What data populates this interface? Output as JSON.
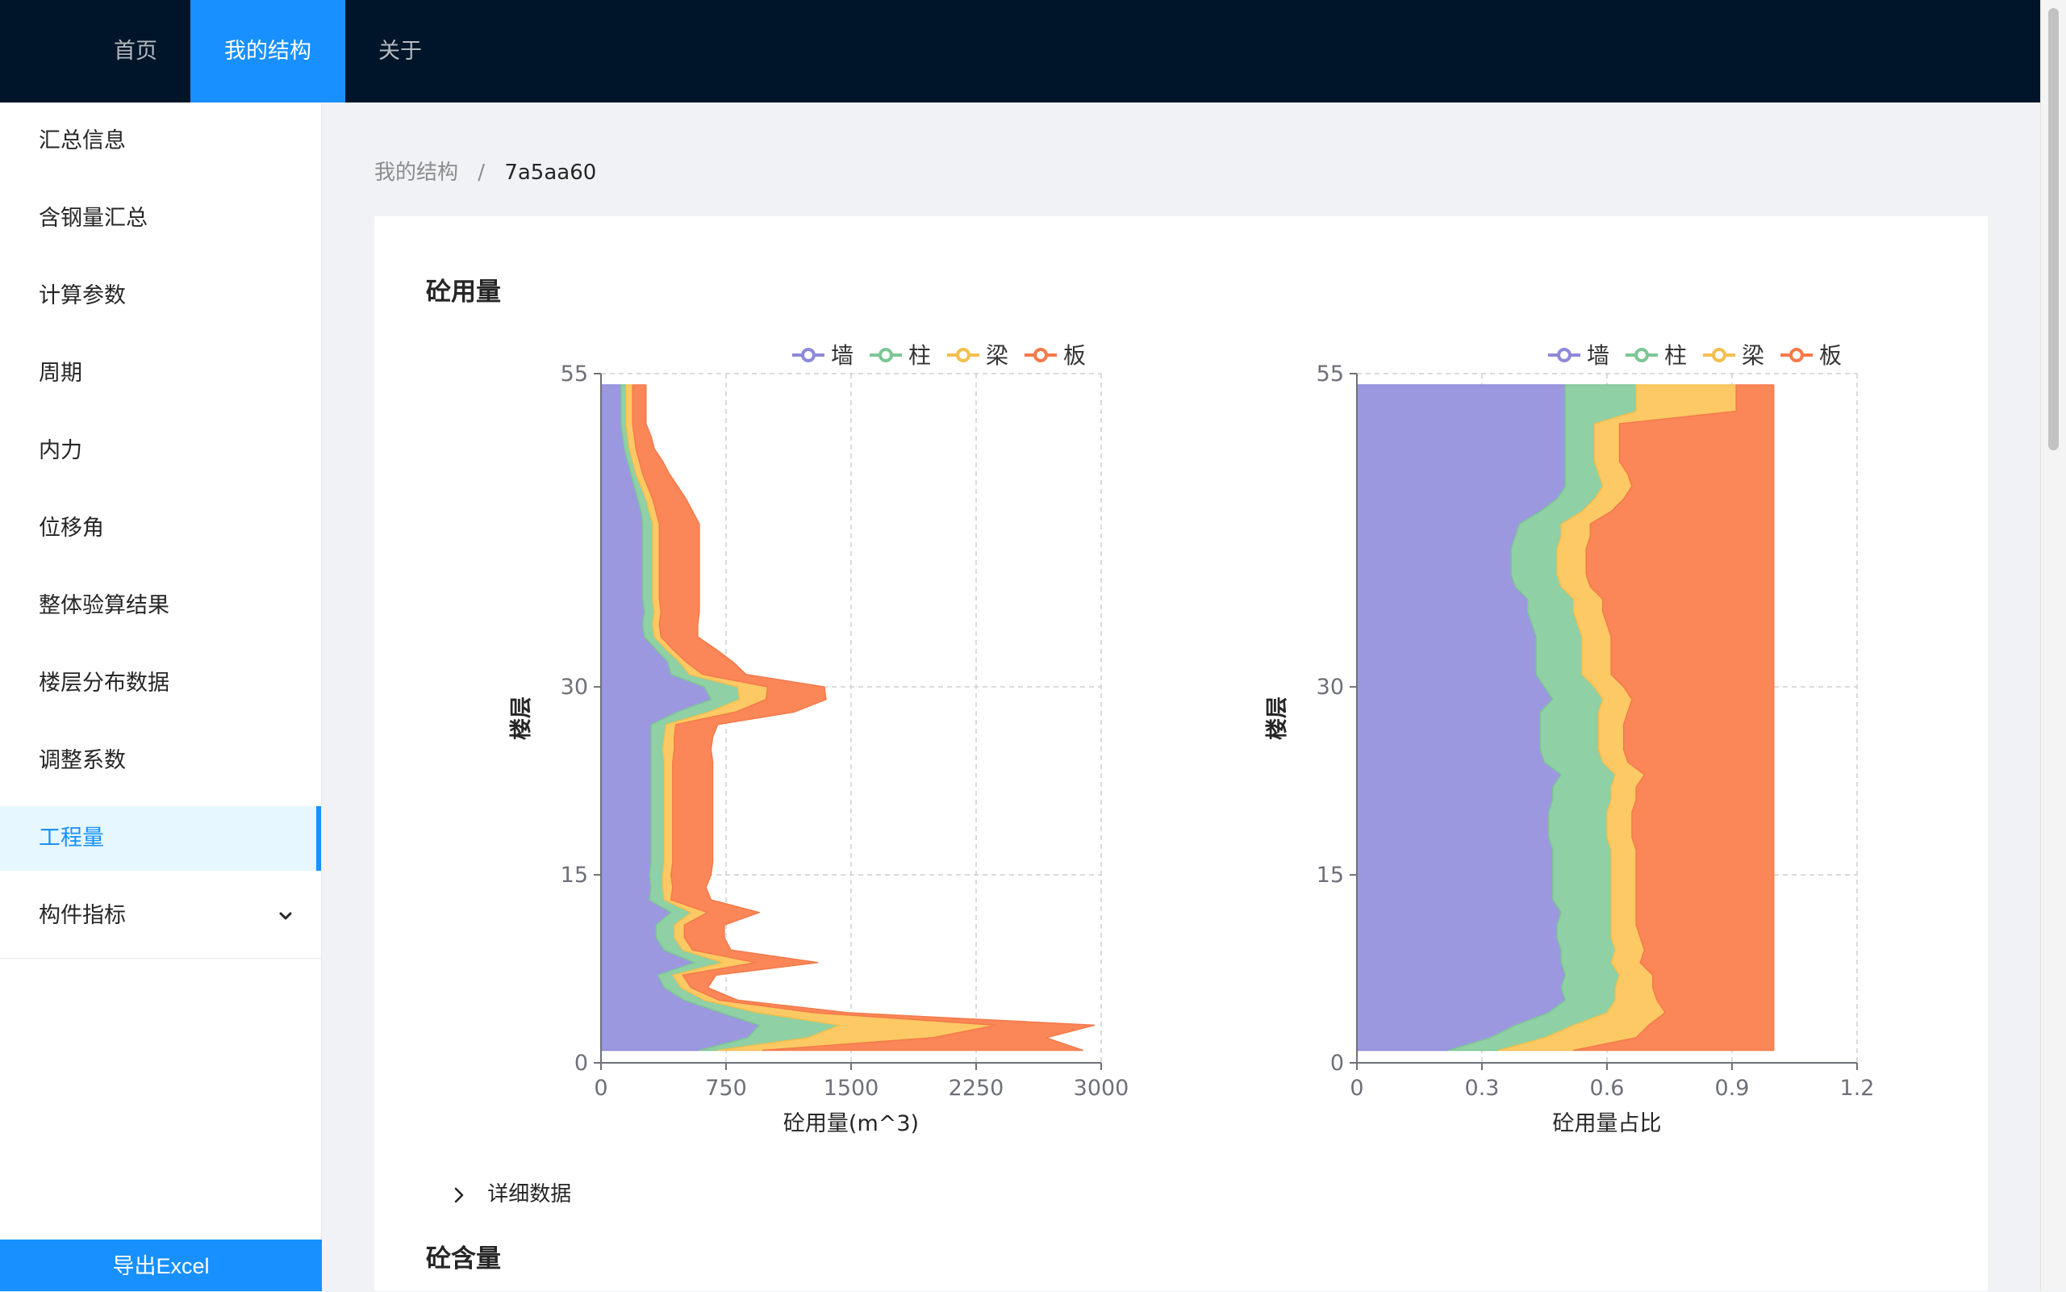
{
  "nav": {
    "items": [
      {
        "label": "首页",
        "active": false
      },
      {
        "label": "我的结构",
        "active": true
      },
      {
        "label": "关于",
        "active": false
      }
    ]
  },
  "sidebar": {
    "items": [
      {
        "label": "汇总信息",
        "active": false
      },
      {
        "label": "含钢量汇总",
        "active": false
      },
      {
        "label": "计算参数",
        "active": false
      },
      {
        "label": "周期",
        "active": false
      },
      {
        "label": "内力",
        "active": false
      },
      {
        "label": "位移角",
        "active": false
      },
      {
        "label": "整体验算结果",
        "active": false
      },
      {
        "label": "楼层分布数据",
        "active": false
      },
      {
        "label": "调整系数",
        "active": false
      },
      {
        "label": "工程量",
        "active": true
      },
      {
        "label": "构件指标",
        "active": false,
        "has_submenu": true,
        "icon": "chevron-down-icon"
      }
    ],
    "export_label": "导出Excel"
  },
  "breadcrumb": {
    "root": "我的结构",
    "separator": "/",
    "current": "7a5aa60"
  },
  "sections": {
    "concrete_volume_title": "砼用量",
    "concrete_content_title": "砼含量",
    "details_label": "详细数据"
  },
  "colors": {
    "primary": "#1890ff",
    "nav_bg": "#001529",
    "wall": "#5470c6",
    "column": "#91cc75",
    "beam": "#fac858",
    "slab": "#ee6666"
  },
  "chart_data": [
    {
      "type": "area",
      "stacked": true,
      "orientation": "horizontal",
      "xlabel": "砼用量(m^3)",
      "ylabel": "楼层",
      "xlim": [
        0,
        3000
      ],
      "ylim": [
        0,
        55
      ],
      "xticks": [
        0,
        750,
        1500,
        2250,
        3000
      ],
      "yticks": [
        0,
        15,
        30,
        55
      ],
      "grid": true,
      "legend_position": "top-right",
      "series_colors": [
        "#9c98e0",
        "#8fd0a5",
        "#fcc964",
        "#fb8657"
      ],
      "floors": [
        1,
        2,
        3,
        4,
        5,
        6,
        7,
        8,
        9,
        10,
        11,
        12,
        13,
        14,
        15,
        16,
        17,
        18,
        19,
        20,
        21,
        22,
        23,
        24,
        25,
        26,
        27,
        28,
        29,
        30,
        31,
        32,
        33,
        34,
        35,
        36,
        37,
        38,
        39,
        40,
        41,
        42,
        43,
        44,
        45,
        46,
        47,
        48,
        49,
        50,
        51,
        52,
        53,
        54,
        54.1
      ],
      "series": [
        {
          "name": "墙",
          "values": [
            590,
            880,
            950,
            720,
            500,
            380,
            340,
            560,
            380,
            330,
            330,
            420,
            290,
            300,
            290,
            300,
            300,
            300,
            300,
            300,
            300,
            300,
            300,
            300,
            300,
            300,
            300,
            460,
            660,
            620,
            420,
            400,
            330,
            260,
            250,
            260,
            250,
            250,
            250,
            250,
            250,
            250,
            250,
            240,
            220,
            200,
            180,
            160,
            140,
            130,
            120,
            120,
            120,
            120,
            120
          ]
        },
        {
          "name": "柱",
          "values": [
            110,
            360,
            480,
            220,
            120,
            100,
            90,
            170,
            110,
            110,
            110,
            120,
            90,
            70,
            80,
            80,
            80,
            80,
            80,
            80,
            80,
            80,
            80,
            80,
            70,
            80,
            90,
            190,
            170,
            200,
            110,
            70,
            60,
            60,
            60,
            60,
            60,
            60,
            60,
            60,
            60,
            60,
            60,
            50,
            50,
            40,
            30,
            30,
            30,
            30,
            30,
            30,
            30,
            30,
            30
          ]
        },
        {
          "name": "梁",
          "values": [
            270,
            750,
            940,
            340,
            90,
            60,
            60,
            200,
            60,
            60,
            60,
            100,
            40,
            60,
            50,
            50,
            50,
            50,
            50,
            50,
            50,
            50,
            50,
            50,
            70,
            60,
            60,
            160,
            160,
            180,
            80,
            40,
            40,
            40,
            40,
            40,
            40,
            40,
            40,
            40,
            40,
            40,
            40,
            40,
            40,
            40,
            40,
            40,
            40,
            40,
            40,
            40,
            40,
            40,
            40
          ]
        },
        {
          "name": "板",
          "values": [
            1920,
            680,
            590,
            200,
            110,
            100,
            200,
            370,
            230,
            240,
            240,
            310,
            240,
            200,
            240,
            240,
            240,
            240,
            240,
            240,
            240,
            240,
            240,
            240,
            220,
            230,
            250,
            350,
            360,
            340,
            260,
            280,
            260,
            220,
            230,
            230,
            240,
            240,
            240,
            240,
            240,
            240,
            240,
            220,
            200,
            180,
            160,
            140,
            110,
            100,
            80,
            80,
            80,
            80,
            80
          ]
        }
      ]
    },
    {
      "type": "area",
      "stacked": true,
      "orientation": "horizontal",
      "xlabel": "砼用量占比",
      "ylabel": "楼层",
      "xlim": [
        0,
        1.2
      ],
      "ylim": [
        0,
        55
      ],
      "xticks": [
        0,
        0.3,
        0.6,
        0.9,
        1.2
      ],
      "yticks": [
        0,
        15,
        30,
        55
      ],
      "grid": true,
      "legend_position": "top-right",
      "series_colors": [
        "#9c98e0",
        "#8fd0a5",
        "#fcc964",
        "#fb8657"
      ],
      "floors": [
        1,
        2,
        3,
        4,
        5,
        6,
        7,
        8,
        9,
        10,
        11,
        12,
        13,
        14,
        15,
        16,
        17,
        18,
        19,
        20,
        21,
        22,
        23,
        24,
        25,
        26,
        27,
        28,
        29,
        30,
        31,
        32,
        33,
        34,
        35,
        36,
        37,
        38,
        39,
        40,
        41,
        42,
        43,
        44,
        45,
        46,
        47,
        48,
        49,
        50,
        51,
        52,
        53,
        54,
        54.1
      ],
      "series": [
        {
          "name": "墙",
          "values": [
            0.22,
            0.32,
            0.38,
            0.46,
            0.5,
            0.49,
            0.5,
            0.49,
            0.49,
            0.48,
            0.48,
            0.49,
            0.47,
            0.47,
            0.47,
            0.47,
            0.47,
            0.46,
            0.46,
            0.46,
            0.47,
            0.47,
            0.49,
            0.45,
            0.44,
            0.44,
            0.44,
            0.44,
            0.47,
            0.45,
            0.43,
            0.43,
            0.43,
            0.43,
            0.42,
            0.41,
            0.41,
            0.38,
            0.37,
            0.37,
            0.37,
            0.38,
            0.39,
            0.44,
            0.48,
            0.5,
            0.5,
            0.5,
            0.5,
            0.5,
            0.5,
            0.5,
            0.5,
            0.5,
            0.5
          ]
        },
        {
          "name": "柱",
          "values": [
            0.12,
            0.13,
            0.14,
            0.14,
            0.12,
            0.13,
            0.13,
            0.12,
            0.13,
            0.13,
            0.13,
            0.12,
            0.14,
            0.14,
            0.14,
            0.14,
            0.14,
            0.14,
            0.14,
            0.14,
            0.14,
            0.14,
            0.13,
            0.14,
            0.14,
            0.14,
            0.14,
            0.14,
            0.12,
            0.12,
            0.11,
            0.11,
            0.11,
            0.11,
            0.11,
            0.11,
            0.11,
            0.11,
            0.11,
            0.11,
            0.11,
            0.11,
            0.1,
            0.1,
            0.09,
            0.09,
            0.08,
            0.07,
            0.07,
            0.07,
            0.07,
            0.17,
            0.17,
            0.17,
            0.17
          ]
        },
        {
          "name": "梁",
          "values": [
            0.18,
            0.22,
            0.18,
            0.14,
            0.1,
            0.09,
            0.08,
            0.07,
            0.07,
            0.07,
            0.06,
            0.06,
            0.06,
            0.06,
            0.06,
            0.06,
            0.06,
            0.06,
            0.06,
            0.06,
            0.06,
            0.06,
            0.07,
            0.06,
            0.06,
            0.06,
            0.06,
            0.07,
            0.07,
            0.07,
            0.07,
            0.07,
            0.07,
            0.07,
            0.07,
            0.07,
            0.07,
            0.07,
            0.07,
            0.07,
            0.07,
            0.07,
            0.07,
            0.07,
            0.07,
            0.07,
            0.07,
            0.06,
            0.06,
            0.06,
            0.06,
            0.24,
            0.24,
            0.24,
            0.24
          ]
        },
        {
          "name": "板",
          "values": [
            0.48,
            0.33,
            0.3,
            0.26,
            0.28,
            0.29,
            0.29,
            0.32,
            0.31,
            0.32,
            0.33,
            0.33,
            0.33,
            0.33,
            0.33,
            0.33,
            0.33,
            0.34,
            0.34,
            0.34,
            0.33,
            0.33,
            0.31,
            0.35,
            0.36,
            0.36,
            0.36,
            0.35,
            0.34,
            0.36,
            0.39,
            0.39,
            0.39,
            0.39,
            0.4,
            0.41,
            0.41,
            0.44,
            0.45,
            0.45,
            0.45,
            0.44,
            0.44,
            0.39,
            0.36,
            0.34,
            0.35,
            0.37,
            0.37,
            0.37,
            0.37,
            0.09,
            0.09,
            0.09,
            0.09
          ]
        }
      ]
    }
  ]
}
